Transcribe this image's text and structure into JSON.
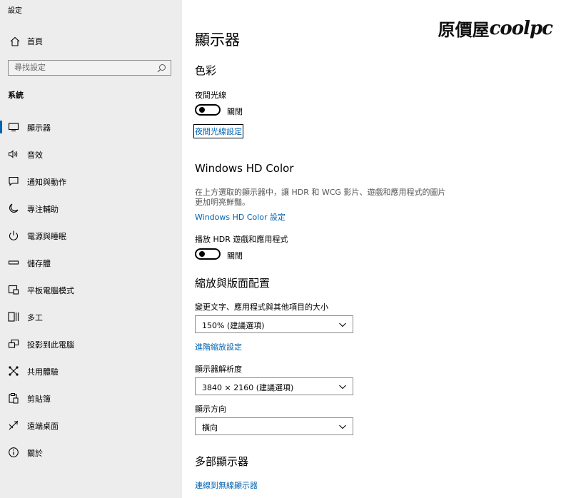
{
  "app": {
    "title": "設定"
  },
  "sidebar": {
    "home_label": "首頁",
    "search_placeholder": "尋找設定",
    "section_title": "系統",
    "items": [
      {
        "label": "顯示器",
        "icon": "monitor-icon",
        "selected": true
      },
      {
        "label": "音效",
        "icon": "speaker-icon"
      },
      {
        "label": "通知與動作",
        "icon": "notification-icon"
      },
      {
        "label": "專注輔助",
        "icon": "moon-icon"
      },
      {
        "label": "電源與睡眠",
        "icon": "power-icon"
      },
      {
        "label": "儲存體",
        "icon": "storage-icon"
      },
      {
        "label": "平板電腦模式",
        "icon": "tablet-icon"
      },
      {
        "label": "多工",
        "icon": "multitask-icon"
      },
      {
        "label": "投影到此電腦",
        "icon": "project-icon"
      },
      {
        "label": "共用體驗",
        "icon": "share-icon"
      },
      {
        "label": "剪貼簿",
        "icon": "clipboard-icon"
      },
      {
        "label": "遠端桌面",
        "icon": "remote-desktop-icon"
      },
      {
        "label": "關於",
        "icon": "info-icon"
      }
    ]
  },
  "watermark": {
    "brand_cjk": "原價屋",
    "brand_latin": "coolpc"
  },
  "main": {
    "page_title": "顯示器",
    "color": {
      "heading": "色彩",
      "night_light_label": "夜間光線",
      "night_light_state": "關閉",
      "night_light_settings_link": "夜間光線設定"
    },
    "hd_color": {
      "heading": "Windows HD Color",
      "description": "在上方選取的顯示器中，讓 HDR 和 WCG 影片、遊戲和應用程式的圖片更加明亮鮮豔。",
      "settings_link": "Windows HD Color 設定",
      "hdr_label": "播放 HDR 遊戲和應用程式",
      "hdr_state": "關閉"
    },
    "scale_layout": {
      "heading": "縮放與版面配置",
      "scale_label": "變更文字、應用程式與其他項目的大小",
      "scale_value": "150% (建議選項)",
      "advanced_link": "進階縮放設定",
      "resolution_label": "顯示器解析度",
      "resolution_value": "3840 × 2160 (建議選項)",
      "orientation_label": "顯示方向",
      "orientation_value": "橫向"
    },
    "multi_display": {
      "heading": "多部顯示器",
      "wireless_link": "連線到無線顯示器"
    }
  }
}
